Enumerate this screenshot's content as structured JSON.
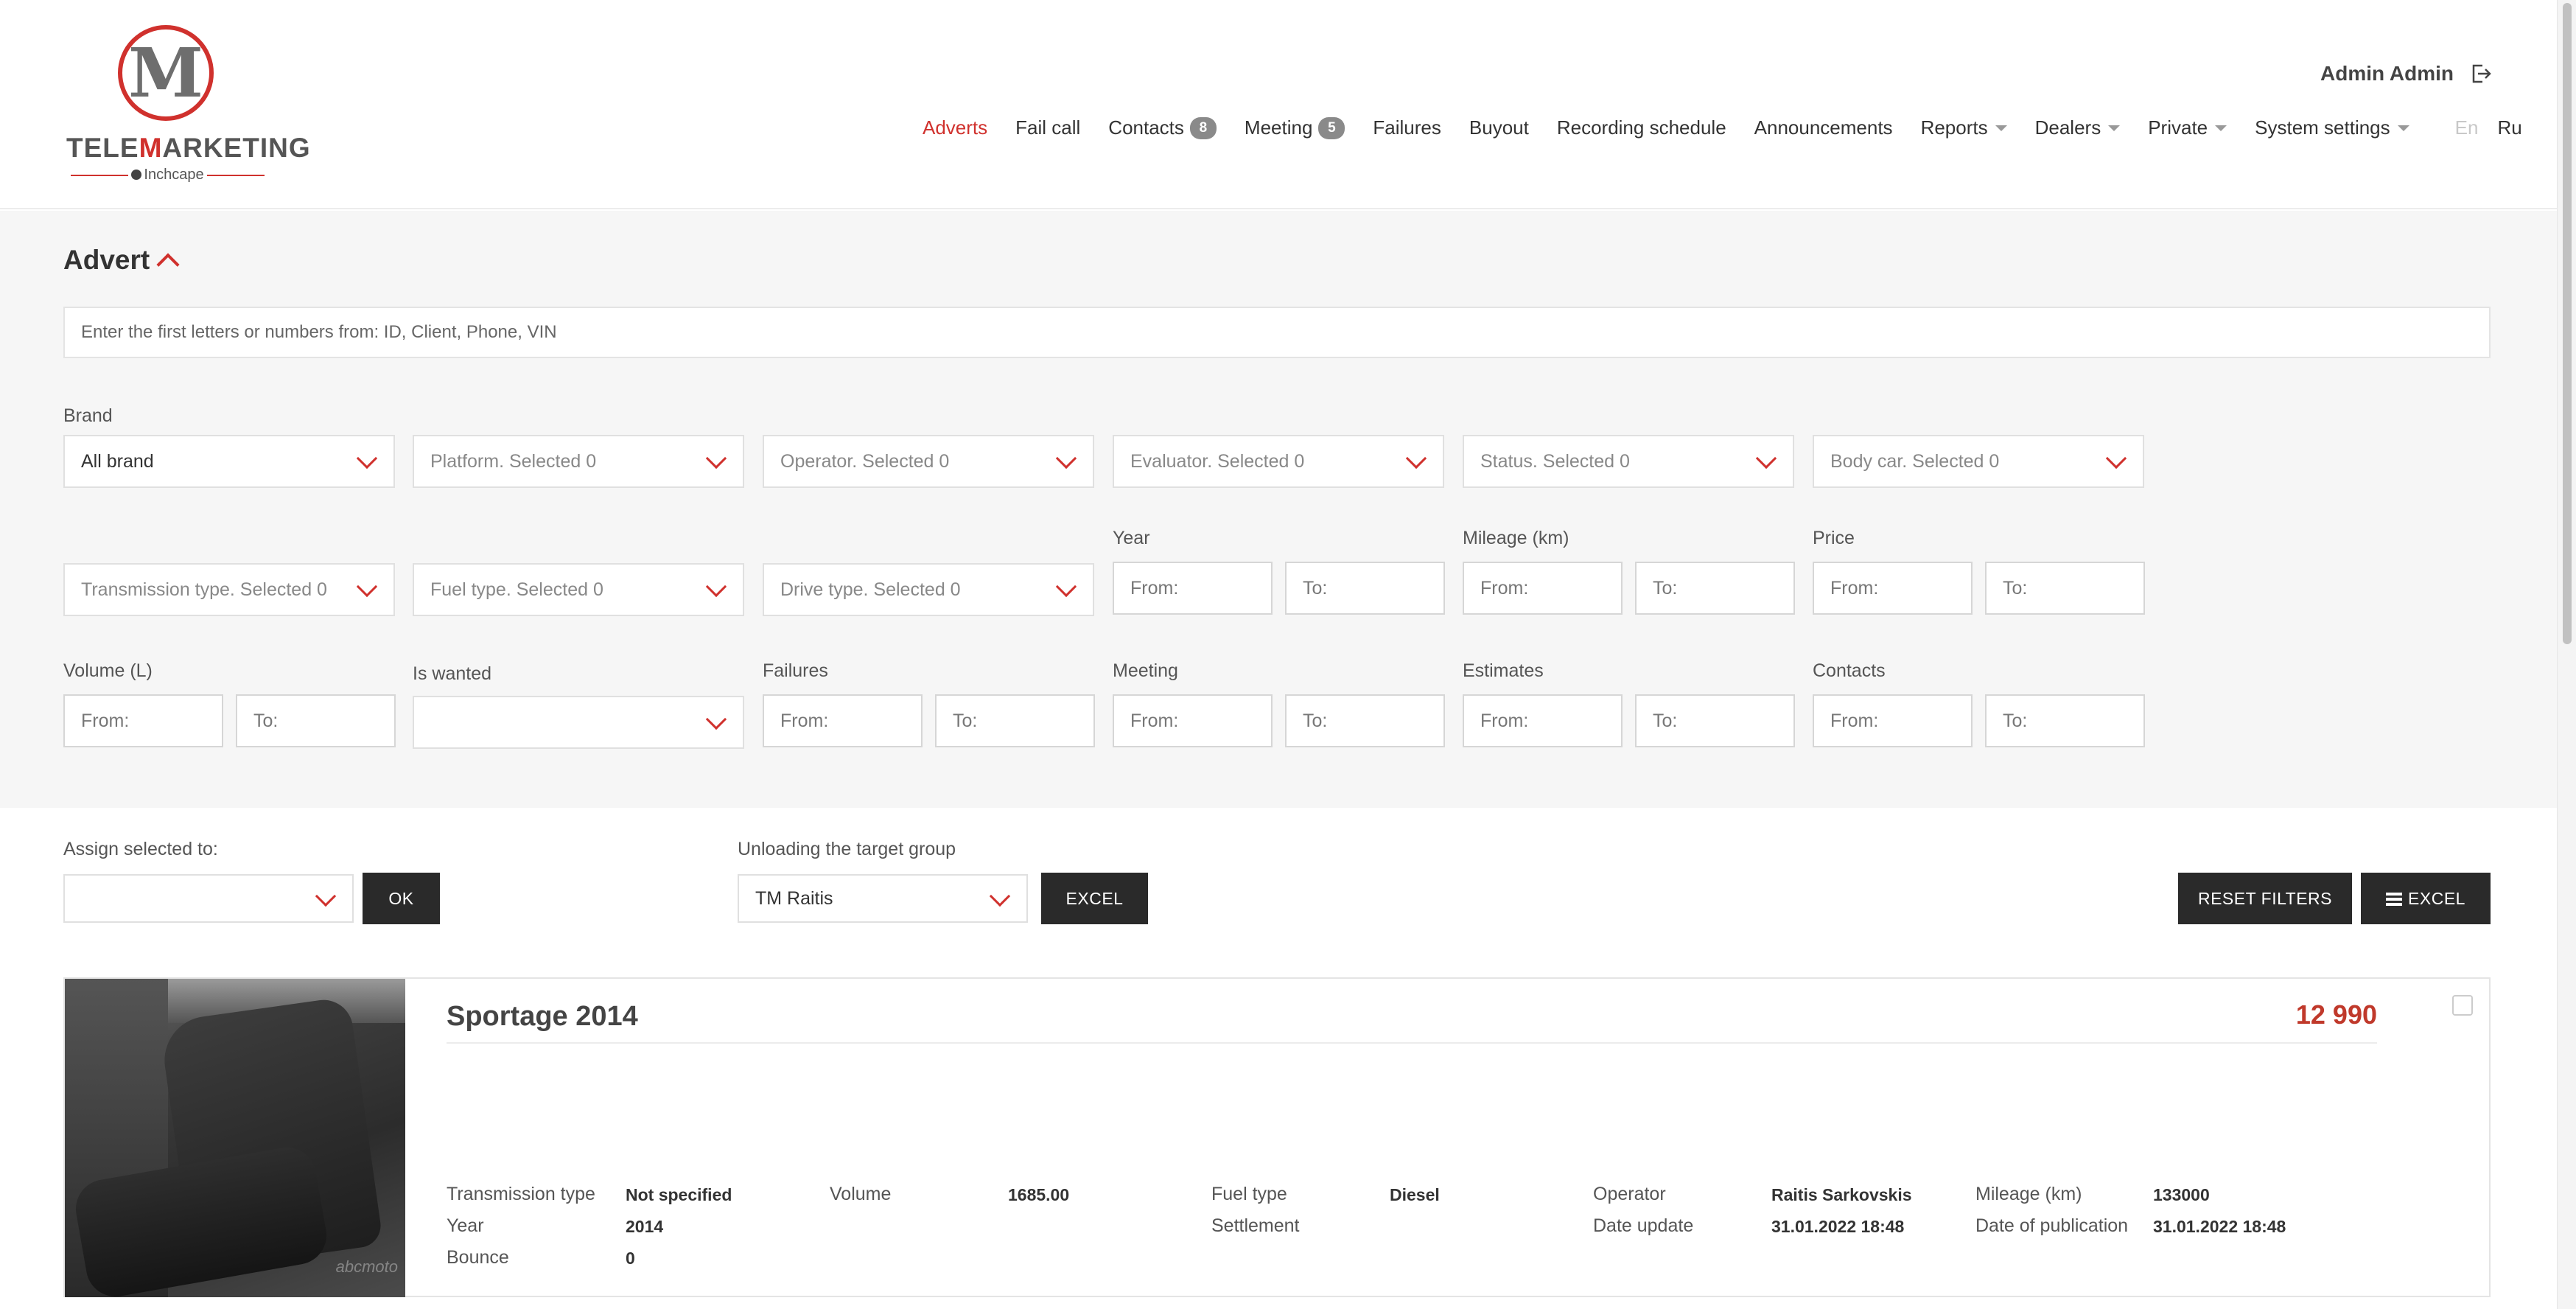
{
  "brand": {
    "logo_letter": "M",
    "name_part1": "TELE",
    "name_red": "M",
    "name_part2": "ARKETING",
    "sub": "Inchcape"
  },
  "user": {
    "name": "Admin Admin"
  },
  "nav": {
    "adverts": "Adverts",
    "fail_call": "Fail call",
    "contacts": "Contacts",
    "contacts_count": "8",
    "meeting": "Meeting",
    "meeting_count": "5",
    "failures": "Failures",
    "buyout": "Buyout",
    "recording_schedule": "Recording schedule",
    "announcements": "Announcements",
    "reports": "Reports",
    "dealers": "Dealers",
    "private": "Private",
    "system_settings": "System settings",
    "lang_en": "En",
    "lang_ru": "Ru"
  },
  "filters": {
    "title": "Advert",
    "search_placeholder": "Enter the first letters or numbers from: ID, Client, Phone, VIN",
    "brand_label": "Brand",
    "brand_value": "All brand",
    "platform": "Platform. Selected 0",
    "operator": "Operator. Selected 0",
    "evaluator": "Evaluator. Selected 0",
    "status": "Status. Selected 0",
    "body_car": "Body car. Selected 0",
    "transmission": "Transmission type. Selected 0",
    "fuel": "Fuel type. Selected 0",
    "drive": "Drive type. Selected 0",
    "year_label": "Year",
    "mileage_label": "Mileage (km)",
    "price_label": "Price",
    "volume_label": "Volume (L)",
    "is_wanted_label": "Is wanted",
    "failures_label": "Failures",
    "meeting_label": "Meeting",
    "estimates_label": "Estimates",
    "contacts_label": "Contacts",
    "from": "From:",
    "to": "To:"
  },
  "actions": {
    "assign_label": "Assign selected to:",
    "ok": "OK",
    "unload_label": "Unloading the target group",
    "unload_value": "TM Raitis",
    "excel": "EXCEL",
    "reset_filters": "RESET FILTERS",
    "excel_list": "EXCEL"
  },
  "card": {
    "title": "Sportage 2014",
    "price": "12 990",
    "watermark": "abcmoto",
    "specs": {
      "transmission_label": "Transmission type",
      "transmission_value": "Not specified",
      "year_label": "Year",
      "year_value": "2014",
      "bounce_label": "Bounce",
      "bounce_value": "0",
      "volume_label": "Volume",
      "volume_value": "1685.00",
      "fuel_label": "Fuel type",
      "fuel_value": "Diesel",
      "settlement_label": "Settlement",
      "operator_label": "Operator",
      "operator_value": "Raitis Sarkovskis",
      "date_update_label": "Date update",
      "date_update_value": "31.01.2022 18:48",
      "mileage_label": "Mileage (km)",
      "mileage_value": "133000",
      "publication_label": "Date of publication",
      "publication_value": "31.01.2022 18:48"
    }
  },
  "colors": {
    "accent": "#d0312d",
    "price": "#c0392b",
    "dark_button": "#2a2a2a",
    "filter_bg": "#f6f6f6"
  }
}
